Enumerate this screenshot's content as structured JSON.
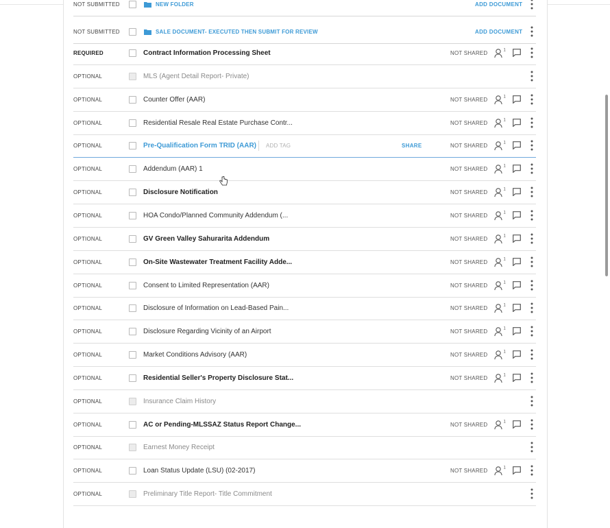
{
  "folders": [
    {
      "status": "NOT SUBMITTED",
      "name": "NEW FOLDER",
      "action": "ADD DOCUMENT"
    },
    {
      "status": "NOT SUBMITTED",
      "name": "SALE DOCUMENT- EXECUTED THEN SUBMIT FOR REVIEW",
      "action": "ADD DOCUMENT"
    }
  ],
  "documents": [
    {
      "status": "REQUIRED",
      "name": "Contract Information Processing Sheet",
      "share_status": "NOT SHARED",
      "user_count": "1"
    },
    {
      "status": "OPTIONAL",
      "name": "MLS (Agent Detail Report- Private)",
      "share_status": "",
      "user_count": ""
    },
    {
      "status": "OPTIONAL",
      "name": "Counter Offer (AAR)",
      "share_status": "NOT SHARED",
      "user_count": "1"
    },
    {
      "status": "OPTIONAL",
      "name": "Residential Resale Real Estate Purchase Contr...",
      "share_status": "NOT SHARED",
      "user_count": "1"
    },
    {
      "status": "OPTIONAL",
      "name": "Pre-Qualification Form TRID (AAR)",
      "add_tag": "ADD TAG",
      "share_action": "SHARE",
      "share_status": "NOT SHARED",
      "user_count": "1"
    },
    {
      "status": "OPTIONAL",
      "name": "Addendum (AAR) 1",
      "share_status": "NOT SHARED",
      "user_count": "1"
    },
    {
      "status": "OPTIONAL",
      "name": "Disclosure Notification",
      "share_status": "NOT SHARED",
      "user_count": "1"
    },
    {
      "status": "OPTIONAL",
      "name": "HOA Condo/Planned Community Addendum (...",
      "share_status": "NOT SHARED",
      "user_count": "1"
    },
    {
      "status": "OPTIONAL",
      "name": "GV Green Valley Sahurarita Addendum",
      "share_status": "NOT SHARED",
      "user_count": "1"
    },
    {
      "status": "OPTIONAL",
      "name": "On-Site Wastewater Treatment Facility Adde...",
      "share_status": "NOT SHARED",
      "user_count": "1"
    },
    {
      "status": "OPTIONAL",
      "name": "Consent to Limited Representation (AAR)",
      "share_status": "NOT SHARED",
      "user_count": "1"
    },
    {
      "status": "OPTIONAL",
      "name": "Disclosure of Information on Lead-Based Pain...",
      "share_status": "NOT SHARED",
      "user_count": "1"
    },
    {
      "status": "OPTIONAL",
      "name": "Disclosure Regarding Vicinity of an Airport",
      "share_status": "NOT SHARED",
      "user_count": "1"
    },
    {
      "status": "OPTIONAL",
      "name": "Market Conditions Advisory (AAR)",
      "share_status": "NOT SHARED",
      "user_count": "1"
    },
    {
      "status": "OPTIONAL",
      "name": "Residential Seller's Property Disclosure Stat...",
      "share_status": "NOT SHARED",
      "user_count": "1"
    },
    {
      "status": "OPTIONAL",
      "name": "Insurance Claim History",
      "share_status": "",
      "user_count": ""
    },
    {
      "status": "OPTIONAL",
      "name": "AC or Pending-MLSSAZ Status Report Change...",
      "share_status": "NOT SHARED",
      "user_count": "1"
    },
    {
      "status": "OPTIONAL",
      "name": "Earnest Money Receipt",
      "share_status": "",
      "user_count": ""
    },
    {
      "status": "OPTIONAL",
      "name": "Loan Status Update (LSU) (02-2017)",
      "share_status": "NOT SHARED",
      "user_count": "1"
    },
    {
      "status": "OPTIONAL",
      "name": "Preliminary Title Report- Title Commitment",
      "share_status": "",
      "user_count": ""
    }
  ],
  "colors": {
    "link": "#3d9ad6",
    "active_row_border": "#6fa9dc",
    "row_border": "#dedede"
  },
  "icons": {
    "folder": "folder-icon",
    "user": "user-count-icon",
    "comment": "comment-icon",
    "more": "more-vertical-icon",
    "cursor": "hand-cursor-icon"
  }
}
